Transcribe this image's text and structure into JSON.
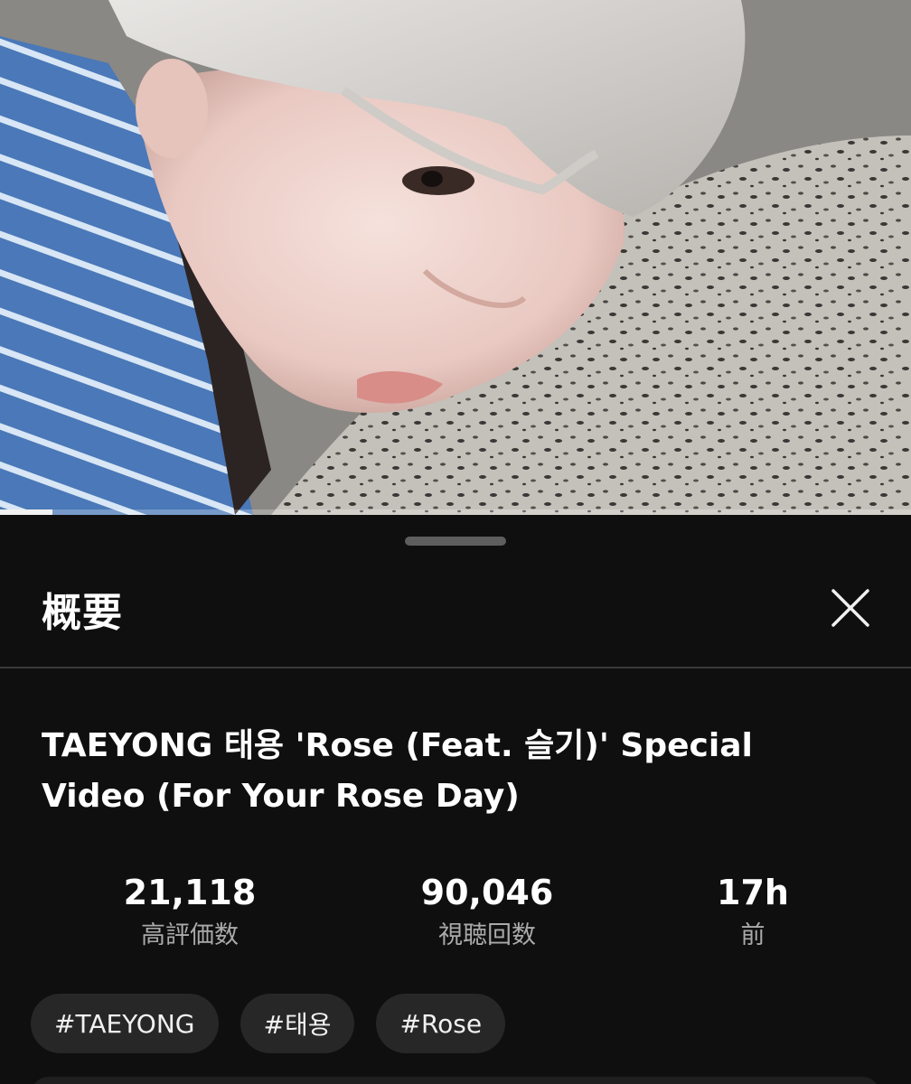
{
  "video": {
    "progress_fraction": 0.058,
    "colors": {
      "background": "#0f0f0f",
      "sheet_background": "#0f0f0f",
      "chip_background": "#272727",
      "divider": "#3a3a3a",
      "secondary_text": "#aaaaaa",
      "progress_fill": "#f1f1f1"
    }
  },
  "sheet": {
    "title": "概要",
    "close_icon": "close-icon"
  },
  "description": {
    "title": "TAEYONG 태용 'Rose (Feat. 슬기)' Special Video (For Your Rose Day)"
  },
  "stats": [
    {
      "value": "21,118",
      "label": "高評価数"
    },
    {
      "value": "90,046",
      "label": "視聴回数"
    },
    {
      "value": "17h",
      "label": "前"
    }
  ],
  "hashtags": [
    "#TAEYONG",
    "#태용",
    "#Rose"
  ]
}
